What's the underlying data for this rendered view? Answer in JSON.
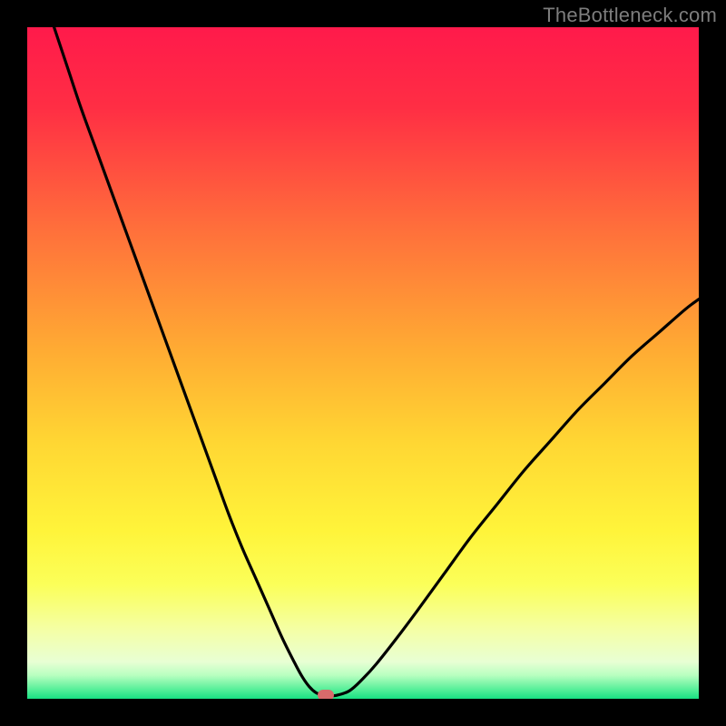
{
  "watermark": "TheBottleneck.com",
  "chart_data": {
    "type": "line",
    "title": "",
    "xlabel": "",
    "ylabel": "",
    "xlim": [
      0,
      100
    ],
    "ylim": [
      0,
      100
    ],
    "series": [
      {
        "name": "bottleneck-curve",
        "x": [
          4,
          6,
          8,
          10,
          12,
          14,
          16,
          18,
          20,
          22,
          24,
          26,
          28,
          30,
          32,
          34,
          36,
          38,
          40,
          41,
          42,
          43,
          44,
          45,
          46,
          48,
          50,
          52,
          55,
          58,
          62,
          66,
          70,
          74,
          78,
          82,
          86,
          90,
          94,
          98,
          100
        ],
        "y": [
          100,
          94,
          88,
          82.5,
          77,
          71.5,
          66,
          60.5,
          55,
          49.5,
          44,
          38.5,
          33,
          27.5,
          22.5,
          18,
          13.5,
          9,
          5,
          3.2,
          1.8,
          0.9,
          0.5,
          0.5,
          0.5,
          1.2,
          3,
          5.2,
          9,
          13,
          18.5,
          24,
          29,
          34,
          38.5,
          43,
          47,
          51,
          54.5,
          58,
          59.5
        ]
      }
    ],
    "marker": {
      "x": 44.5,
      "y": 0.5
    },
    "gradient_stops": [
      {
        "offset": 0,
        "color": "#ff1a4b"
      },
      {
        "offset": 0.12,
        "color": "#ff2e44"
      },
      {
        "offset": 0.3,
        "color": "#ff6f3b"
      },
      {
        "offset": 0.48,
        "color": "#ffab33"
      },
      {
        "offset": 0.62,
        "color": "#ffd733"
      },
      {
        "offset": 0.75,
        "color": "#fff43a"
      },
      {
        "offset": 0.83,
        "color": "#fbff59"
      },
      {
        "offset": 0.9,
        "color": "#f4ffa8"
      },
      {
        "offset": 0.945,
        "color": "#e8ffd4"
      },
      {
        "offset": 0.965,
        "color": "#b8ffc0"
      },
      {
        "offset": 0.985,
        "color": "#5cf09b"
      },
      {
        "offset": 1.0,
        "color": "#18e083"
      }
    ]
  }
}
